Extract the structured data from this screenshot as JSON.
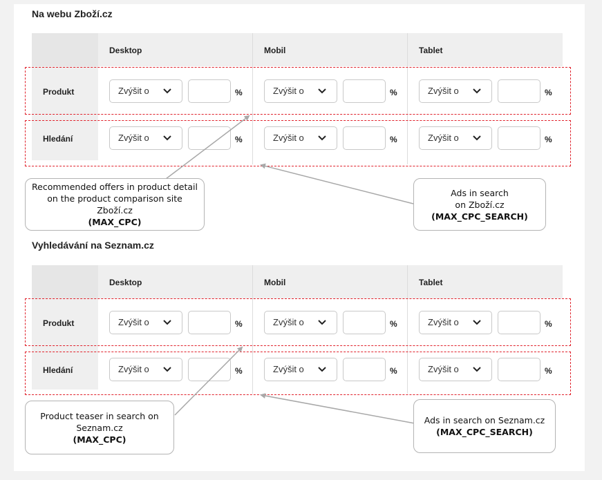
{
  "sections": [
    {
      "title": "Na webu Zboží.cz",
      "columns": [
        "Desktop",
        "Mobil",
        "Tablet"
      ],
      "rows": [
        {
          "label": "Produkt",
          "select": "Zvýšit o",
          "unit": "%"
        },
        {
          "label": "Hledání",
          "select": "Zvýšit o",
          "unit": "%"
        }
      ],
      "callouts": [
        {
          "lines": [
            "Recommended offers in product detail",
            "on the product comparison site",
            "Zboží.cz"
          ],
          "code": "(MAX_CPC)"
        },
        {
          "lines": [
            "Ads in search",
            "on Zboží.cz"
          ],
          "code": "(MAX_CPC_SEARCH)"
        }
      ]
    },
    {
      "title": "Vyhledávání na Seznam.cz",
      "columns": [
        "Desktop",
        "Mobil",
        "Tablet"
      ],
      "rows": [
        {
          "label": "Produkt",
          "select": "Zvýšit o",
          "unit": "%"
        },
        {
          "label": "Hledání",
          "select": "Zvýšit o",
          "unit": "%"
        }
      ],
      "callouts": [
        {
          "lines": [
            "Product teaser in search on",
            "Seznam.cz"
          ],
          "code": "(MAX_CPC)"
        },
        {
          "lines": [
            "Ads in search on Seznam.cz"
          ],
          "code": "(MAX_CPC_SEARCH)"
        }
      ]
    }
  ],
  "colors": {
    "highlight": "#e0202a",
    "header_bg": "#efefef",
    "callout_border": "#b3b3b3"
  },
  "icons": {
    "select_chevron": "chevron-down-icon"
  }
}
